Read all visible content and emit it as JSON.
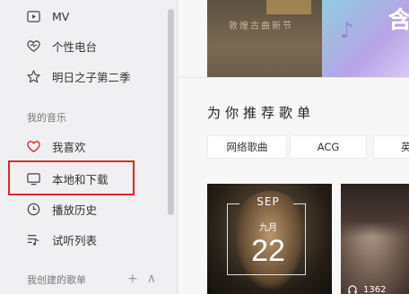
{
  "sidebar": {
    "items_top": [
      {
        "label": "MV",
        "icon": "mv-icon"
      },
      {
        "label": "个性电台",
        "icon": "radio-heart-icon"
      },
      {
        "label": "明日之子第二季",
        "icon": "star-icon"
      }
    ],
    "my_music_title": "我的音乐",
    "my_music_items": [
      {
        "label": "我喜欢",
        "icon": "heart-icon"
      },
      {
        "label": "本地和下载",
        "icon": "monitor-icon"
      },
      {
        "label": "播放历史",
        "icon": "clock-icon"
      },
      {
        "label": "试听列表",
        "icon": "playlist-icon"
      }
    ],
    "created_title": "我创建的歌单",
    "add_symbol": "+",
    "collapse_symbol": "∧"
  },
  "main": {
    "banner_left_text": "敦煌古曲新节",
    "banner_right_text": "含",
    "recommend_title": "为你推荐歌单",
    "tags": [
      "网络歌曲",
      "ACG",
      "英"
    ],
    "card1": {
      "month_en": "SEP",
      "month_cn": "九月",
      "day": "22"
    },
    "card2": {
      "play_count": "1362"
    }
  },
  "colors": {
    "highlight_border": "#e0262a",
    "heart": "#e0262a"
  }
}
